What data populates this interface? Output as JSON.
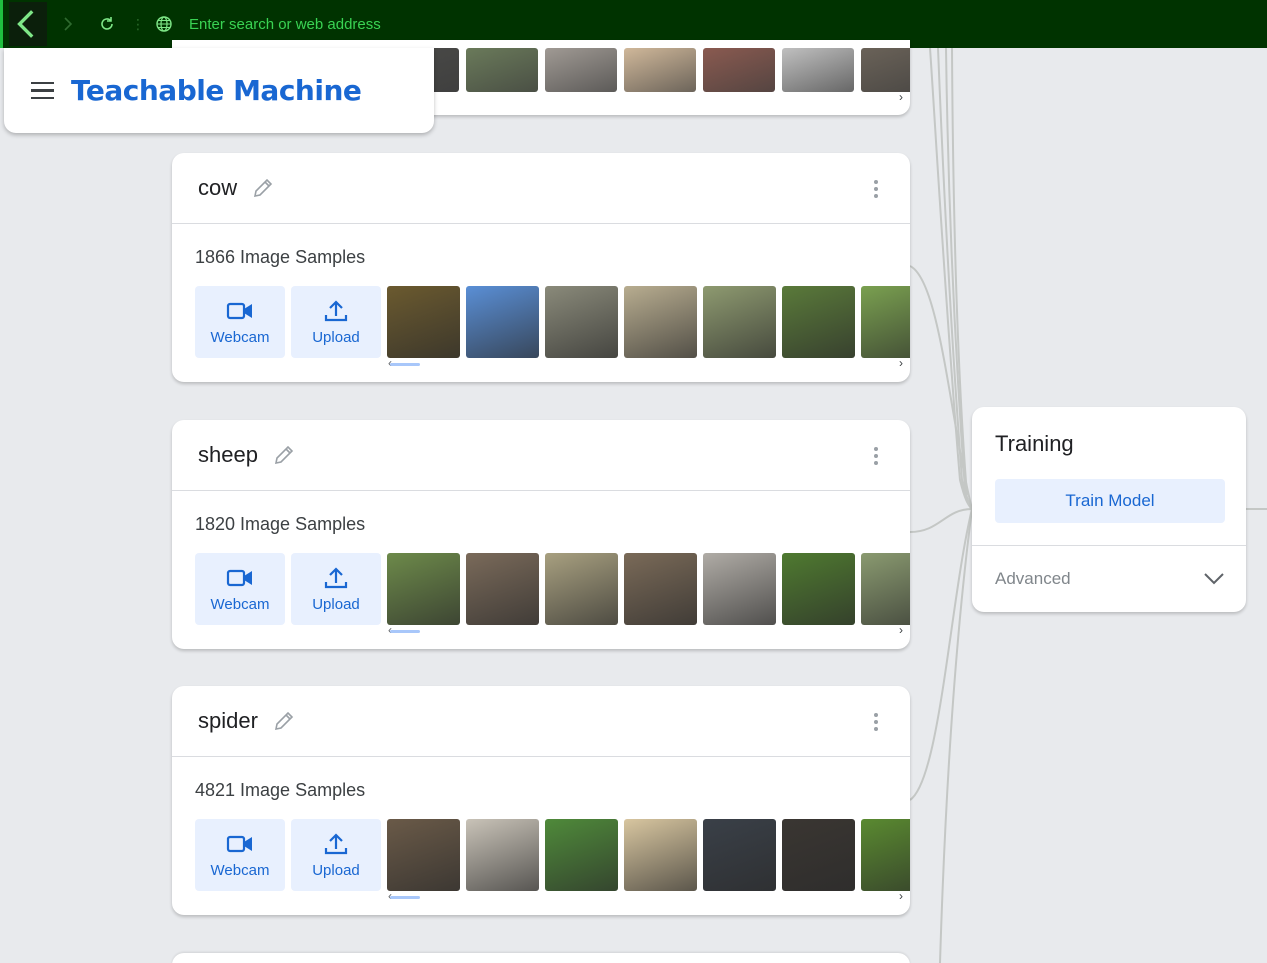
{
  "browser": {
    "address_placeholder": "Enter search or web address"
  },
  "app": {
    "title": "Teachable Machine"
  },
  "classes": [
    {
      "name": "cow",
      "samples": "1866 Image Samples",
      "webcam_label": "Webcam",
      "upload_label": "Upload",
      "thumb_colors": [
        "#6b5a2f",
        "#5a8fd6",
        "#8a8a7a",
        "#b8ad90",
        "#8e9a70",
        "#5a7a3a",
        "#7aa050"
      ]
    },
    {
      "name": "sheep",
      "samples": "1820 Image Samples",
      "webcam_label": "Webcam",
      "upload_label": "Upload",
      "thumb_colors": [
        "#6d8a4a",
        "#7a6a5a",
        "#a8a080",
        "#7a6a58",
        "#b0aca6",
        "#4f7a30",
        "#8a9a70"
      ]
    },
    {
      "name": "spider",
      "samples": "4821 Image Samples",
      "webcam_label": "Webcam",
      "upload_label": "Upload",
      "thumb_colors": [
        "#6a5a48",
        "#c9c3b8",
        "#4f8a3a",
        "#d8c6a0",
        "#3a4048",
        "#3a3632",
        "#5a8a30"
      ]
    }
  ],
  "top_thumb_colors": [
    "#4a4a48",
    "#6a7a5a",
    "#a09a94",
    "#d0b89a",
    "#8a5a50",
    "#c0c0c0",
    "#6a6258"
  ],
  "training": {
    "title": "Training",
    "train_button": "Train Model",
    "advanced_label": "Advanced"
  }
}
